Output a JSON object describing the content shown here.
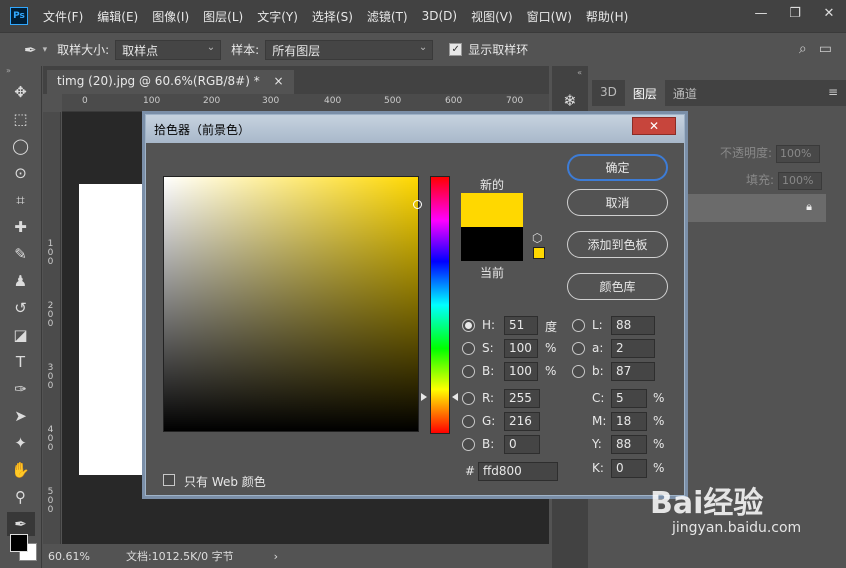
{
  "app": {
    "logo": "Ps"
  },
  "menu": [
    "文件(F)",
    "编辑(E)",
    "图像(I)",
    "图层(L)",
    "文字(Y)",
    "选择(S)",
    "滤镜(T)",
    "3D(D)",
    "视图(V)",
    "窗口(W)",
    "帮助(H)"
  ],
  "window_controls": {
    "minimize": "—",
    "restore": "❐",
    "close": "✕"
  },
  "options": {
    "sample_size_label": "取样大小:",
    "sample_size_value": "取样点",
    "sample_label": "样本:",
    "sample_value": "所有图层",
    "show_ring_label": "显示取样环",
    "show_ring_checked": true
  },
  "document": {
    "tab_title": "timg (20).jpg @ 60.6%(RGB/8#) *",
    "tab_close": "×",
    "ruler_top": [
      "0",
      "100",
      "200",
      "300",
      "400",
      "500",
      "600",
      "700"
    ],
    "ruler_left": [
      "1",
      "0",
      "0",
      "2",
      "0",
      "0",
      "3",
      "0",
      "0",
      "4",
      "0",
      "0",
      "5",
      "0",
      "0"
    ],
    "zoom": "60.61%",
    "doc_info": "文档:1012.5K/0 字节"
  },
  "right_panel": {
    "tabs": [
      "3D",
      "图层",
      "通道"
    ],
    "active_tab": "图层",
    "opacity_label": "不透明度:",
    "opacity_value": "100%",
    "fill_label": "填充:",
    "fill_value": "100%"
  },
  "dialog": {
    "title": "拾色器（前景色）",
    "close": "✕",
    "new_label": "新的",
    "current_label": "当前",
    "new_color": "#ffd800",
    "current_color": "#000000",
    "buttons": {
      "ok": "确定",
      "cancel": "取消",
      "add_swatch": "添加到色板",
      "color_library": "颜色库"
    },
    "only_web_label": "只有 Web 颜色",
    "hsb": {
      "h_label": "H:",
      "h": "51",
      "h_unit": "度",
      "s_label": "S:",
      "s": "100",
      "s_unit": "%",
      "b_label": "B:",
      "b": "100",
      "b_unit": "%"
    },
    "rgb": {
      "r_label": "R:",
      "r": "255",
      "g_label": "G:",
      "g": "216",
      "b_label": "B:",
      "b": "0"
    },
    "lab": {
      "l_label": "L:",
      "l": "88",
      "a_label": "a:",
      "a": "2",
      "b_label": "b:",
      "b": "87"
    },
    "cmyk": {
      "c_label": "C:",
      "c": "5",
      "m_label": "M:",
      "m": "18",
      "y_label": "Y:",
      "y": "88",
      "k_label": "K:",
      "k": "0",
      "unit": "%"
    },
    "hex_label": "#",
    "hex": "ffd800"
  },
  "watermark": {
    "logo": "Bai经验",
    "url": "jingyan.baidu.com"
  }
}
